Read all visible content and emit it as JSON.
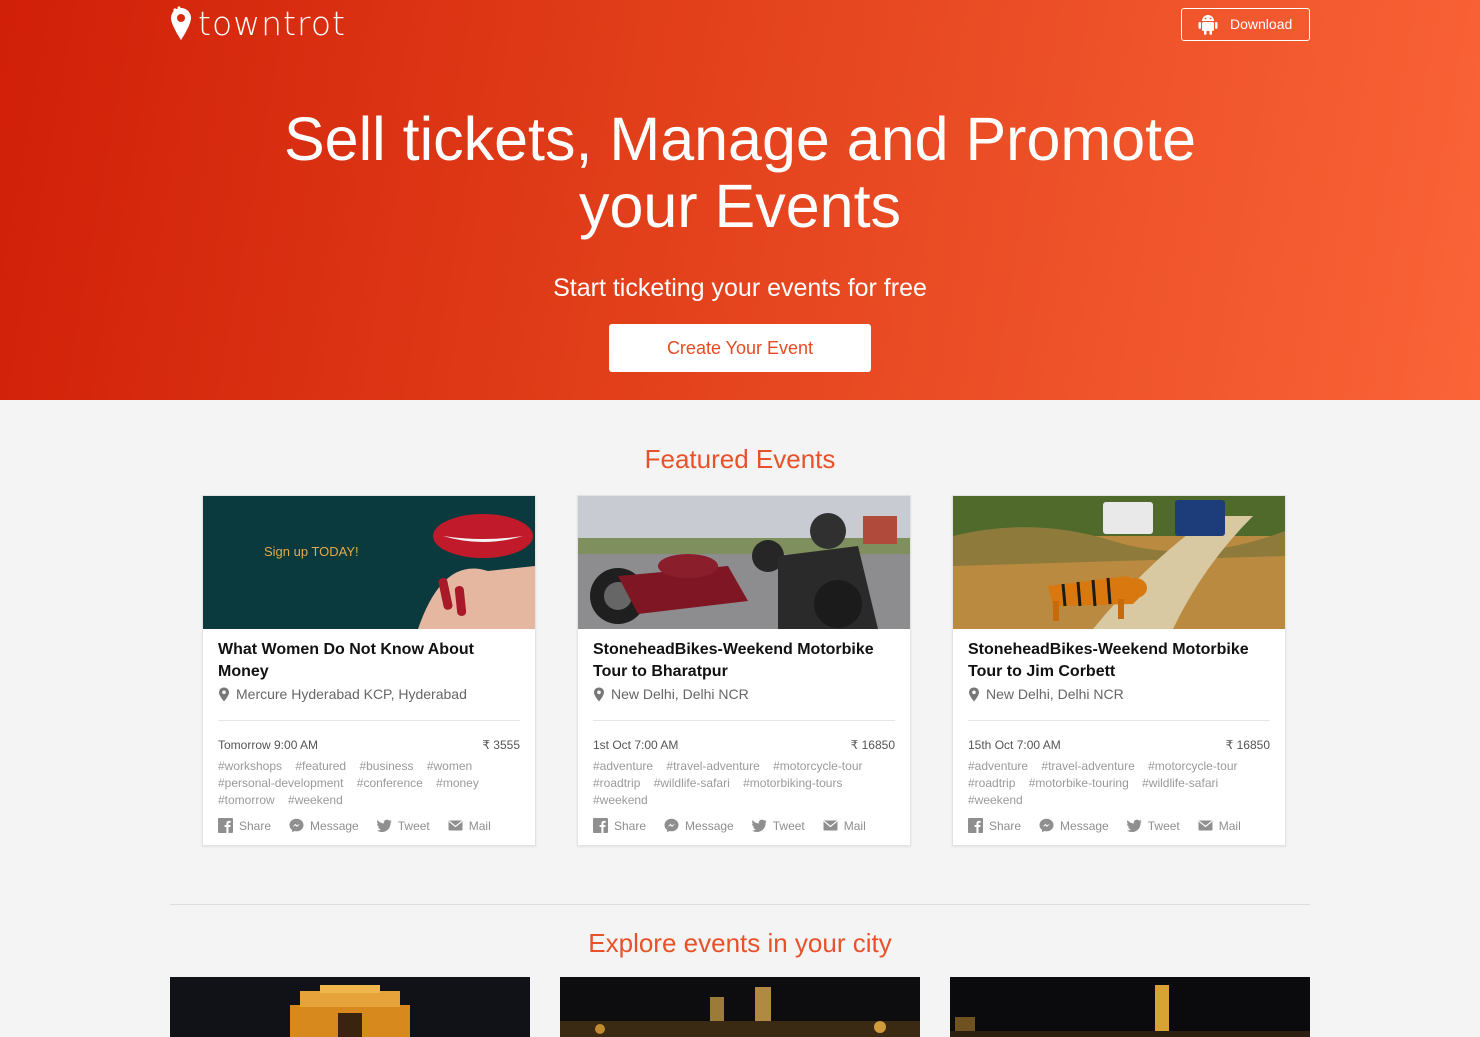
{
  "brand": {
    "name": "towntrot",
    "accent": "#e8522a"
  },
  "header": {
    "download_label": "Download"
  },
  "hero": {
    "title_line1": "Sell tickets, Manage and Promote",
    "title_line2": "your Events",
    "subtitle": "Start ticketing your events for free",
    "cta_label": "Create Your Event"
  },
  "featured": {
    "title": "Featured Events",
    "events": [
      {
        "title": "What Women Do Not Know About Money",
        "venue": "Mercure Hyderabad KCP, Hyderabad",
        "time": "Tomorrow 9:00 AM",
        "price": "₹ 3555",
        "image_text": "Sign up TODAY!",
        "tags": [
          "#workshops",
          "#featured",
          "#business",
          "#women",
          "#personal-development",
          "#conference",
          "#money",
          "#tomorrow",
          "#weekend"
        ]
      },
      {
        "title": "StoneheadBikes-Weekend Motorbike Tour to Bharatpur",
        "venue": "New Delhi, Delhi NCR",
        "time": "1st Oct 7:00 AM",
        "price": "₹ 16850",
        "tags": [
          "#adventure",
          "#travel-adventure",
          "#motorcycle-tour",
          "#roadtrip",
          "#wildlife-safari",
          "#motorbiking-tours",
          "#weekend"
        ]
      },
      {
        "title": "StoneheadBikes-Weekend Motorbike Tour to Jim Corbett",
        "venue": "New Delhi, Delhi NCR",
        "time": "15th Oct 7:00 AM",
        "price": "₹ 16850",
        "tags": [
          "#adventure",
          "#travel-adventure",
          "#motorcycle-tour",
          "#roadtrip",
          "#motorbike-touring",
          "#wildlife-safari",
          "#weekend"
        ]
      }
    ],
    "share": {
      "share": "Share",
      "message": "Message",
      "tweet": "Tweet",
      "mail": "Mail"
    }
  },
  "explore": {
    "title": "Explore events in your city"
  }
}
